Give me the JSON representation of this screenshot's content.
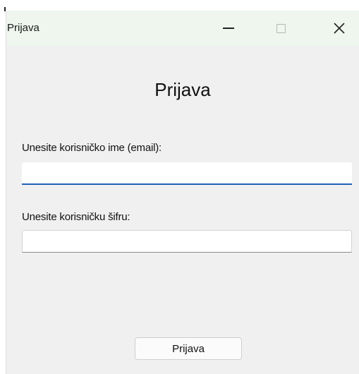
{
  "window": {
    "title": "Prijava",
    "controls": {
      "minimize_icon": "minimize-icon",
      "maximize_icon": "maximize-icon",
      "close_icon": "close-icon",
      "close_glyph": "✕"
    }
  },
  "form": {
    "heading": "Prijava",
    "username_label": "Unesite korisničko ime (email):",
    "username_value": "",
    "password_label": "Unesite korisničku šifru:",
    "password_value": "",
    "submit_label": "Prijava"
  },
  "colors": {
    "titlebar_bg": "#eef6ee",
    "window_bg": "#f0f0f0",
    "focus_accent": "#1e62b6"
  }
}
